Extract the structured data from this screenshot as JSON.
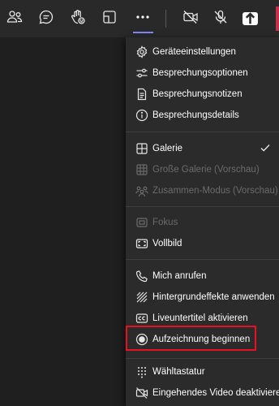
{
  "toolbar": {
    "buttons": [
      {
        "icon": "people-icon"
      },
      {
        "icon": "chat-icon"
      },
      {
        "icon": "raise-hand-icon"
      },
      {
        "icon": "rooms-icon"
      },
      {
        "icon": "more-options-icon"
      },
      {
        "icon": "camera-off-icon"
      },
      {
        "icon": "mic-off-icon"
      },
      {
        "icon": "share-screen-icon"
      }
    ],
    "accent_color": "#7f85f5",
    "leave_color": "#c4314b"
  },
  "menu": {
    "items": [
      {
        "label": "Geräteeinstellungen",
        "icon": "settings-icon"
      },
      {
        "label": "Besprechungsoptionen",
        "icon": "options-icon"
      },
      {
        "label": "Besprechungsnotizen",
        "icon": "notes-icon"
      },
      {
        "label": "Besprechungsdetails",
        "icon": "info-icon"
      },
      {
        "label": "Galerie",
        "icon": "gallery-icon",
        "checked": true
      },
      {
        "label": "Große Galerie (Vorschau)",
        "icon": "large-gallery-icon",
        "disabled": true
      },
      {
        "label": "Zusammen-Modus (Vorschau)",
        "icon": "together-mode-icon",
        "disabled": true
      },
      {
        "label": "Fokus",
        "icon": "focus-icon",
        "disabled": true
      },
      {
        "label": "Vollbild",
        "icon": "fullscreen-icon"
      },
      {
        "label": "Mich anrufen",
        "icon": "phone-icon"
      },
      {
        "label": "Hintergrundeffekte anwenden",
        "icon": "background-effects-icon"
      },
      {
        "label": "Liveuntertitel aktivieren",
        "icon": "captions-icon"
      },
      {
        "label": "Aufzeichnung beginnen",
        "icon": "record-icon",
        "highlighted": true
      },
      {
        "label": "Wähltastatur",
        "icon": "dialpad-icon"
      },
      {
        "label": "Eingehendes Video deaktivieren",
        "icon": "video-off-icon"
      }
    ],
    "highlight_color": "#e81123"
  }
}
